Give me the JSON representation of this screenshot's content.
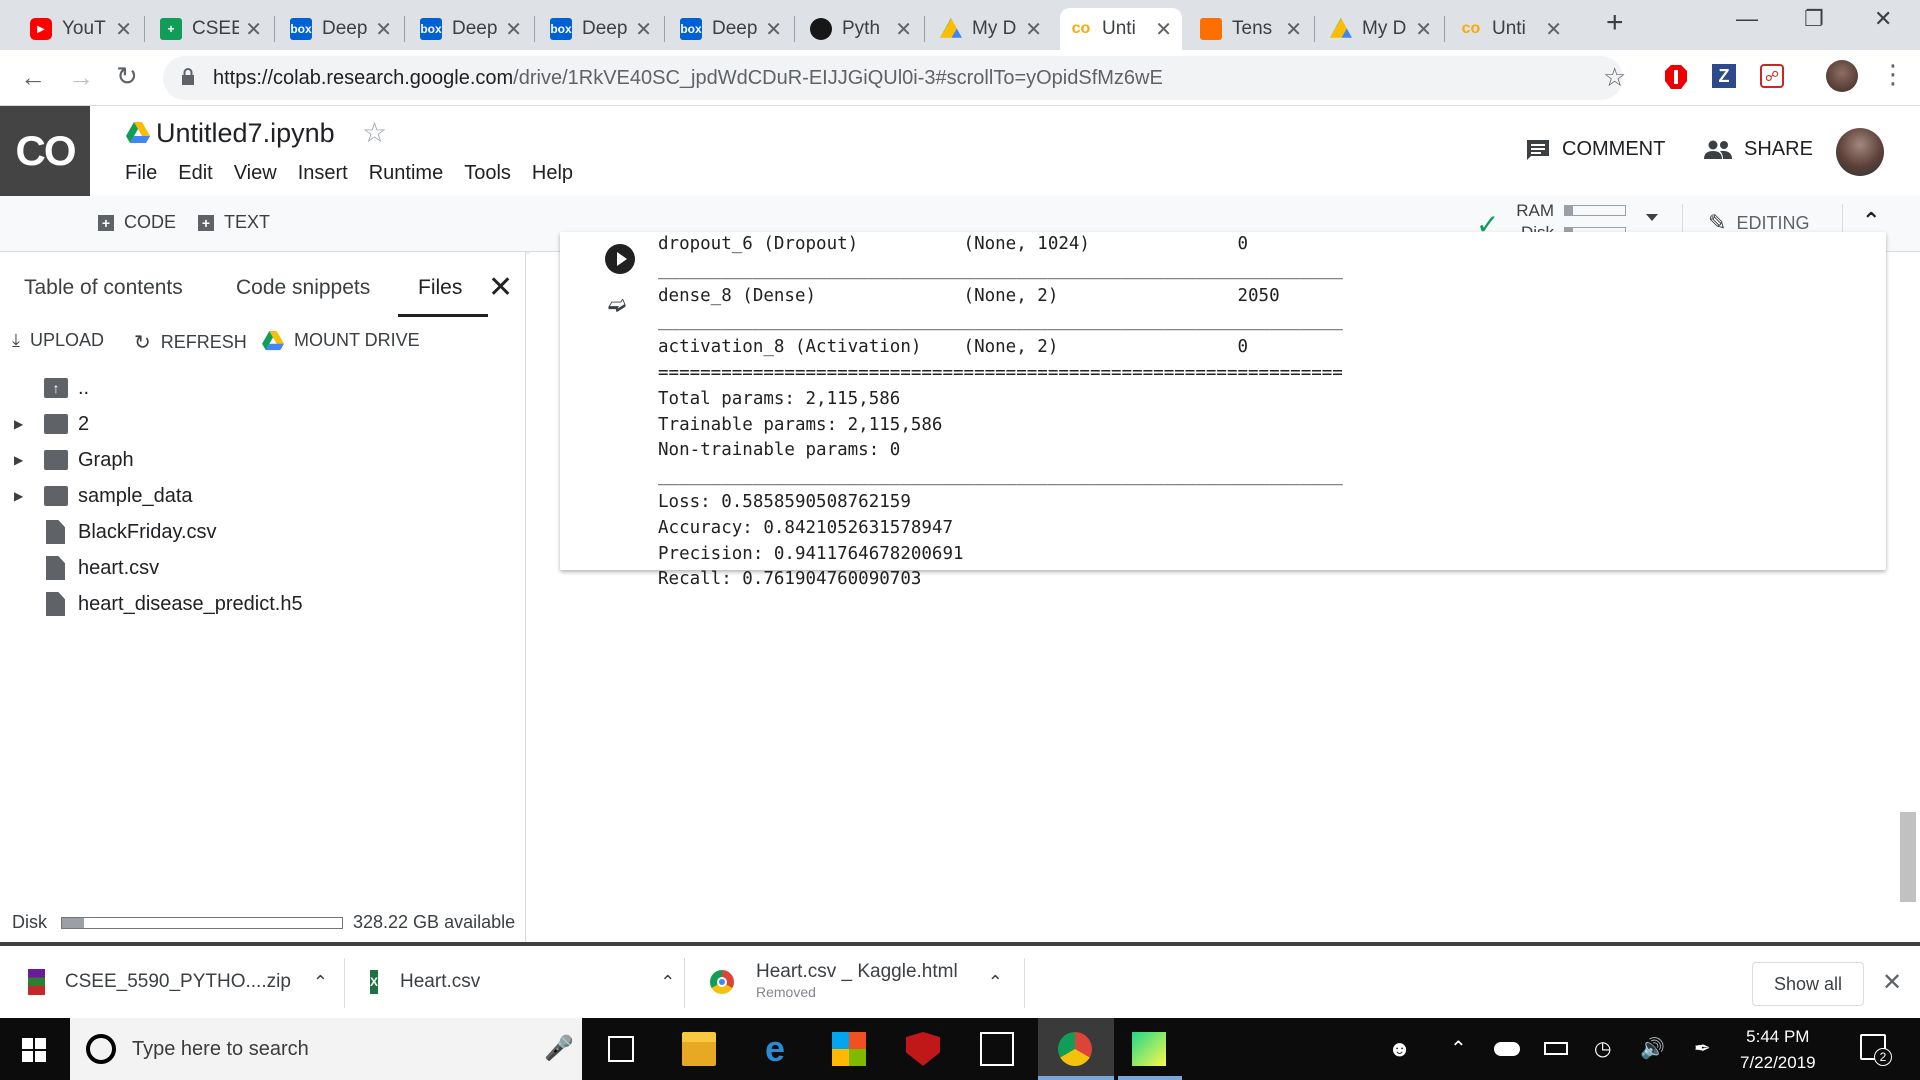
{
  "browser": {
    "tabs": [
      {
        "title": "YouT",
        "icon": "youtube-icon",
        "color": "#ff0000"
      },
      {
        "title": "CSEE",
        "icon": "sheets-icon",
        "color": "#0f9d58"
      },
      {
        "title": "Deep",
        "icon": "box-icon",
        "color": "#0061d5"
      },
      {
        "title": "Deep",
        "icon": "box-icon",
        "color": "#0061d5"
      },
      {
        "title": "Deep",
        "icon": "box-icon",
        "color": "#0061d5"
      },
      {
        "title": "Deep",
        "icon": "box-icon",
        "color": "#0061d5"
      },
      {
        "title": "Pyth",
        "icon": "github-icon",
        "color": "#181717"
      },
      {
        "title": "My D",
        "icon": "drive-icon",
        "color": "#fbbc04"
      },
      {
        "title": "Unti",
        "icon": "colab-icon",
        "color": "#f9ab00"
      },
      {
        "title": "Tens",
        "icon": "tensorboard-icon",
        "color": "#ff6f00"
      },
      {
        "title": "My D",
        "icon": "drive-icon",
        "color": "#fbbc04"
      },
      {
        "title": "Unti",
        "icon": "colab-icon",
        "color": "#f9ab00"
      }
    ],
    "active_tab": 8,
    "url_prefix": "https://colab.research.google.com",
    "url_rest": "/drive/1RkVE40SC_jpdWdCDuR-EIJJGiQUl0i-3#scrollTo=yOpidSfMz6wE"
  },
  "colab": {
    "logo": "CO",
    "title": "Untitled7.ipynb",
    "menu": [
      "File",
      "Edit",
      "View",
      "Insert",
      "Runtime",
      "Tools",
      "Help"
    ],
    "comment_label": "COMMENT",
    "share_label": "SHARE",
    "code_label": "CODE",
    "text_label": "TEXT",
    "ram_label": "RAM",
    "disk_label": "Disk",
    "editing_label": "EDITING"
  },
  "sidepanel": {
    "tabs": [
      "Table of contents",
      "Code snippets",
      "Files"
    ],
    "upload_label": "UPLOAD",
    "refresh_label": "REFRESH",
    "mount_label": "MOUNT DRIVE",
    "files": [
      {
        "name": "..",
        "type": "up",
        "expandable": false
      },
      {
        "name": "2",
        "type": "folder",
        "expandable": true
      },
      {
        "name": "Graph",
        "type": "folder",
        "expandable": true
      },
      {
        "name": "sample_data",
        "type": "folder",
        "expandable": true
      },
      {
        "name": "BlackFriday.csv",
        "type": "file",
        "expandable": false
      },
      {
        "name": "heart.csv",
        "type": "file",
        "expandable": false
      },
      {
        "name": "heart_disease_predict.h5",
        "type": "file",
        "expandable": false
      }
    ],
    "disk_label": "Disk",
    "disk_available": "328.22 GB available",
    "disk_used_fraction": 0.08
  },
  "output": {
    "lines": [
      "dropout_6 (Dropout)          (None, 1024)              0         ",
      "_________________________________________________________________",
      "dense_8 (Dense)              (None, 2)                 2050      ",
      "_________________________________________________________________",
      "activation_8 (Activation)    (None, 2)                 0         ",
      "=================================================================",
      "Total params: 2,115,586",
      "Trainable params: 2,115,586",
      "Non-trainable params: 0",
      "_________________________________________________________________",
      "Loss: 0.5858590508762159",
      "Accuracy: 0.8421052631578947",
      "Precision: 0.9411764678200691",
      "Recall: 0.761904760090703"
    ]
  },
  "downloads": [
    {
      "name": "CSEE_5590_PYTHO....zip",
      "status": ""
    },
    {
      "name": "Heart.csv",
      "status": ""
    },
    {
      "name": "Heart.csv _ Kaggle.html",
      "status": "Removed"
    }
  ],
  "show_all_label": "Show all",
  "taskbar": {
    "search_placeholder": "Type here to search",
    "time": "5:44 PM",
    "date": "7/22/2019",
    "notification_count": "2"
  }
}
